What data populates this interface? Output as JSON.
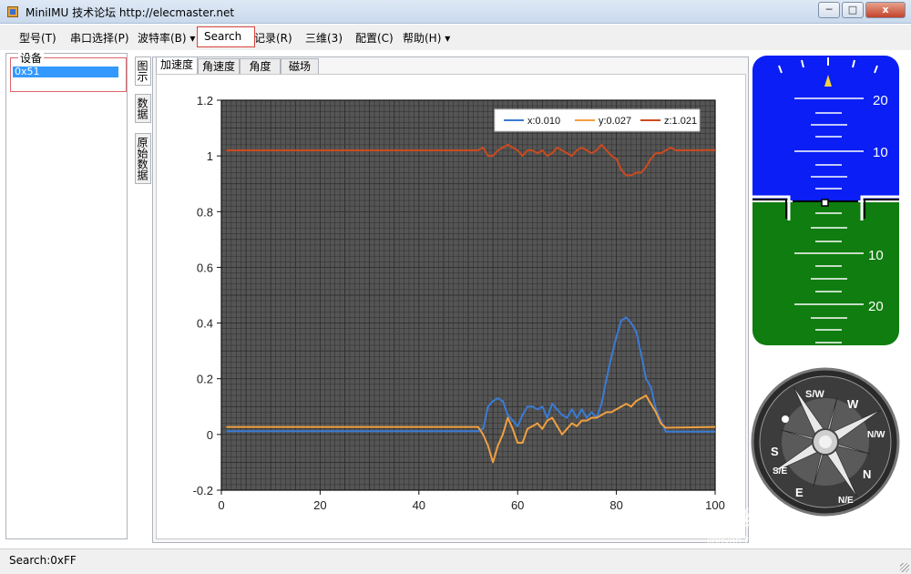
{
  "window": {
    "title": "MiniIMU 技术论坛 http://elecmaster.net",
    "minimize": "─",
    "maximize": "□",
    "close": "x"
  },
  "menu": {
    "items": [
      "型号(T)",
      "串口选择(P)",
      "波特率(B) ▾",
      "记录(R)",
      "三维(3)",
      "配置(C)",
      "帮助(H) ▾"
    ],
    "search_label": "Search"
  },
  "devices": {
    "group_label": "设备",
    "items": [
      "0x51"
    ]
  },
  "side_tabs": [
    "图示",
    "数据",
    "原始数据"
  ],
  "chart_tabs": [
    "加速度",
    "角速度",
    "角度",
    "磁场"
  ],
  "status": {
    "text": "Search:0xFF"
  },
  "attitude": {
    "pitch_labels": [
      "20",
      "10",
      "10",
      "20"
    ],
    "sky_color": "#0a1ef5",
    "ground_color": "#0f7d0f"
  },
  "compass": {
    "labels": [
      "S/W",
      "W",
      "N/W",
      "N",
      "N/E",
      "E",
      "S/E",
      "S"
    ]
  },
  "watermark": {
    "text": "Bai 经验",
    "url": "jingyan.baidu.com"
  },
  "chart_data": {
    "type": "line",
    "title": "",
    "xlim": [
      0,
      100
    ],
    "ylim": [
      -0.2,
      1.2
    ],
    "x_ticks": [
      "0",
      "20",
      "40",
      "60",
      "80",
      "100"
    ],
    "y_ticks": [
      "-0.2",
      "0",
      "0.2",
      "0.4",
      "0.6",
      "0.8",
      "1",
      "1.2"
    ],
    "grid": true,
    "legend_position": "top-right",
    "background": "#555555",
    "series": [
      {
        "name": "x:0.010",
        "color": "#3a7bd5",
        "points": [
          [
            1,
            0.012
          ],
          [
            52,
            0.012
          ],
          [
            53,
            0.02
          ],
          [
            54,
            0.1
          ],
          [
            55,
            0.12
          ],
          [
            56,
            0.13
          ],
          [
            57,
            0.12
          ],
          [
            58,
            0.07
          ],
          [
            59,
            0.05
          ],
          [
            60,
            0.03
          ],
          [
            61,
            0.07
          ],
          [
            62,
            0.1
          ],
          [
            63,
            0.1
          ],
          [
            64,
            0.09
          ],
          [
            65,
            0.1
          ],
          [
            66,
            0.06
          ],
          [
            67,
            0.11
          ],
          [
            68,
            0.09
          ],
          [
            69,
            0.07
          ],
          [
            70,
            0.06
          ],
          [
            71,
            0.09
          ],
          [
            72,
            0.06
          ],
          [
            73,
            0.09
          ],
          [
            74,
            0.06
          ],
          [
            75,
            0.08
          ],
          [
            76,
            0.06
          ],
          [
            77,
            0.11
          ],
          [
            78,
            0.2
          ],
          [
            79,
            0.28
          ],
          [
            80,
            0.35
          ],
          [
            81,
            0.41
          ],
          [
            82,
            0.42
          ],
          [
            83,
            0.4
          ],
          [
            84,
            0.37
          ],
          [
            85,
            0.29
          ],
          [
            86,
            0.2
          ],
          [
            87,
            0.17
          ],
          [
            88,
            0.09
          ],
          [
            89,
            0.05
          ],
          [
            90,
            0.01
          ],
          [
            100,
            0.01
          ]
        ]
      },
      {
        "name": "y:0.027",
        "color": "#f0a040",
        "points": [
          [
            1,
            0.027
          ],
          [
            52,
            0.027
          ],
          [
            53,
            0.0
          ],
          [
            54,
            -0.04
          ],
          [
            55,
            -0.1
          ],
          [
            56,
            -0.04
          ],
          [
            57,
            0.0
          ],
          [
            58,
            0.06
          ],
          [
            59,
            0.02
          ],
          [
            60,
            -0.03
          ],
          [
            61,
            -0.03
          ],
          [
            62,
            0.02
          ],
          [
            63,
            0.03
          ],
          [
            64,
            0.04
          ],
          [
            65,
            0.02
          ],
          [
            66,
            0.05
          ],
          [
            67,
            0.06
          ],
          [
            68,
            0.03
          ],
          [
            69,
            0.0
          ],
          [
            70,
            0.02
          ],
          [
            71,
            0.04
          ],
          [
            72,
            0.03
          ],
          [
            73,
            0.05
          ],
          [
            74,
            0.05
          ],
          [
            75,
            0.06
          ],
          [
            76,
            0.06
          ],
          [
            77,
            0.07
          ],
          [
            78,
            0.08
          ],
          [
            79,
            0.08
          ],
          [
            80,
            0.09
          ],
          [
            81,
            0.1
          ],
          [
            82,
            0.11
          ],
          [
            83,
            0.1
          ],
          [
            84,
            0.12
          ],
          [
            85,
            0.13
          ],
          [
            86,
            0.14
          ],
          [
            87,
            0.11
          ],
          [
            88,
            0.08
          ],
          [
            89,
            0.04
          ],
          [
            90,
            0.024
          ],
          [
            100,
            0.027
          ]
        ]
      },
      {
        "name": "z:1.021",
        "color": "#cc4a1e",
        "points": [
          [
            1,
            1.02
          ],
          [
            52,
            1.02
          ],
          [
            53,
            1.03
          ],
          [
            54,
            1.0
          ],
          [
            55,
            1.0
          ],
          [
            56,
            1.02
          ],
          [
            57,
            1.03
          ],
          [
            58,
            1.04
          ],
          [
            59,
            1.03
          ],
          [
            60,
            1.02
          ],
          [
            61,
            1.0
          ],
          [
            62,
            1.02
          ],
          [
            63,
            1.02
          ],
          [
            64,
            1.01
          ],
          [
            65,
            1.02
          ],
          [
            66,
            1.0
          ],
          [
            67,
            1.01
          ],
          [
            68,
            1.03
          ],
          [
            69,
            1.02
          ],
          [
            70,
            1.01
          ],
          [
            71,
            1.0
          ],
          [
            72,
            1.02
          ],
          [
            73,
            1.03
          ],
          [
            74,
            1.02
          ],
          [
            75,
            1.01
          ],
          [
            76,
            1.02
          ],
          [
            77,
            1.04
          ],
          [
            78,
            1.02
          ],
          [
            79,
            1.0
          ],
          [
            80,
            0.99
          ],
          [
            81,
            0.95
          ],
          [
            82,
            0.93
          ],
          [
            83,
            0.93
          ],
          [
            84,
            0.94
          ],
          [
            85,
            0.94
          ],
          [
            86,
            0.96
          ],
          [
            87,
            0.99
          ],
          [
            88,
            1.01
          ],
          [
            89,
            1.01
          ],
          [
            90,
            1.02
          ],
          [
            91,
            1.03
          ],
          [
            92,
            1.02
          ],
          [
            100,
            1.021
          ]
        ]
      }
    ]
  }
}
